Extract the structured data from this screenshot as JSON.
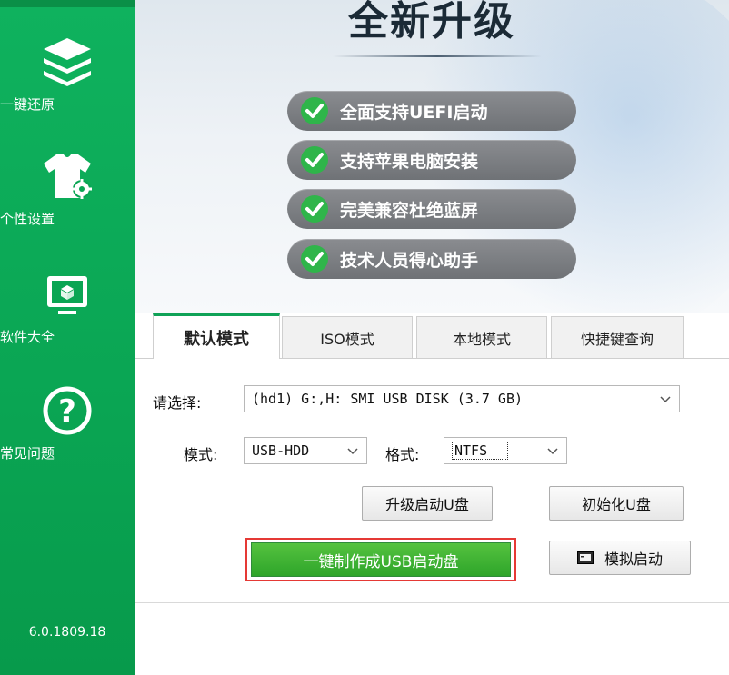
{
  "sidebar": {
    "items": [
      {
        "label": "一键还原",
        "icon": "layers-icon"
      },
      {
        "label": "个性设置",
        "icon": "tshirt-gear-icon"
      },
      {
        "label": "软件大全",
        "icon": "monitor-icon"
      },
      {
        "label": "常见问题",
        "icon": "question-icon"
      }
    ],
    "version": "6.0.1809.18"
  },
  "banner": {
    "title": "全新升级",
    "features": [
      "全面支持UEFI启动",
      "支持苹果电脑安装",
      "完美兼容杜绝蓝屏",
      "技术人员得心助手"
    ]
  },
  "tabs": [
    {
      "label": "默认模式",
      "active": true
    },
    {
      "label": "ISO模式",
      "active": false
    },
    {
      "label": "本地模式",
      "active": false
    },
    {
      "label": "快捷键查询",
      "active": false
    }
  ],
  "form": {
    "select_label": "请选择:",
    "device_value": "(hd1) G:,H: SMI USB DISK (3.7 GB)",
    "mode_label": "模式:",
    "mode_value": "USB-HDD",
    "format_label": "格式:",
    "format_value": "NTFS"
  },
  "buttons": {
    "upgrade": "升级启动U盘",
    "init": "初始化U盘",
    "make": "一键制作成USB启动盘",
    "simulate": "模拟启动"
  },
  "colors": {
    "sidebar": "#0aa553",
    "accent_green": "#2ea52a",
    "highlight_red": "#e53935",
    "pill": "#7a7c80"
  }
}
